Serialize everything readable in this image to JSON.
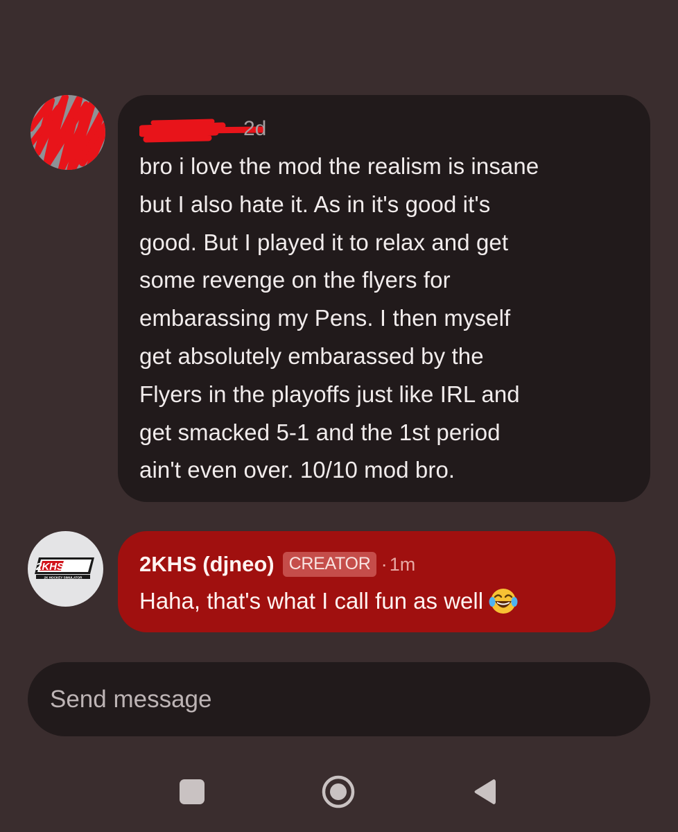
{
  "comments": [
    {
      "author_name": "",
      "author_redacted": true,
      "timestamp": "2d",
      "avatar_icon": "redacted-avatar",
      "bubble_color": "#211a1b",
      "lines": [
        "bro i love the mod the realism is insane",
        "but I also hate it. As in it's good it's",
        "good. But I played it to relax and get",
        "some revenge on the flyers for",
        "embarassing my Pens. I then myself",
        "get absolutely embarassed by the",
        "Flyers in the playoffs just like IRL and",
        "get smacked 5-1 and the 1st period",
        "ain't even over. 10/10 mod bro."
      ]
    },
    {
      "author_name": "2KHS (djneo)",
      "badge": "CREATOR",
      "separator": "·",
      "timestamp": "1m",
      "avatar_icon": "2khs-logo",
      "avatar_logo_text": "2KHS",
      "avatar_logo_subtext": "2K HOCKEY SIMULATOR",
      "bubble_color": "#a0100f",
      "text": "Haha, that's what I call fun as well",
      "emoji": "face-with-tears-of-joy"
    }
  ],
  "composer": {
    "placeholder": "Send message"
  },
  "navbar": {
    "items": [
      "recents-button",
      "home-button",
      "back-button"
    ]
  },
  "colors": {
    "background": "#3a2d2e",
    "bubble_dark": "#211a1b",
    "bubble_creator": "#a0100f",
    "redaction": "#e8141a"
  }
}
